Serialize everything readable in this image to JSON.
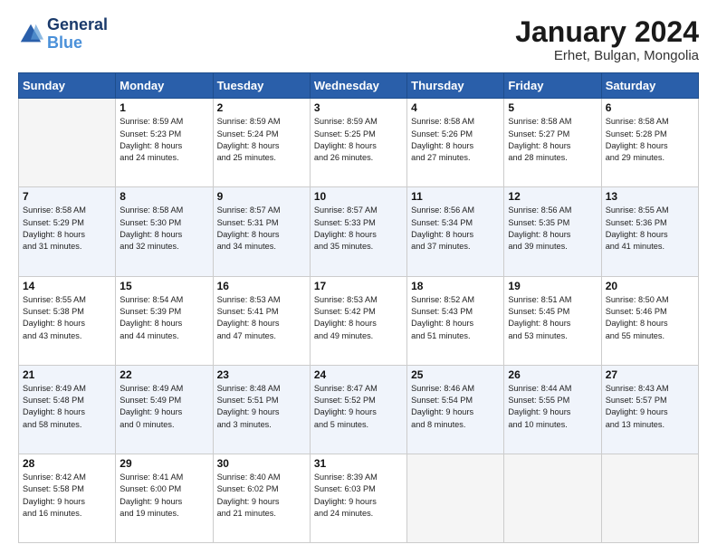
{
  "header": {
    "logo_line1": "General",
    "logo_line2": "Blue",
    "title": "January 2024",
    "subtitle": "Erhet, Bulgan, Mongolia"
  },
  "days_of_week": [
    "Sunday",
    "Monday",
    "Tuesday",
    "Wednesday",
    "Thursday",
    "Friday",
    "Saturday"
  ],
  "weeks": [
    [
      {
        "day": "",
        "info": ""
      },
      {
        "day": "1",
        "info": "Sunrise: 8:59 AM\nSunset: 5:23 PM\nDaylight: 8 hours\nand 24 minutes."
      },
      {
        "day": "2",
        "info": "Sunrise: 8:59 AM\nSunset: 5:24 PM\nDaylight: 8 hours\nand 25 minutes."
      },
      {
        "day": "3",
        "info": "Sunrise: 8:59 AM\nSunset: 5:25 PM\nDaylight: 8 hours\nand 26 minutes."
      },
      {
        "day": "4",
        "info": "Sunrise: 8:58 AM\nSunset: 5:26 PM\nDaylight: 8 hours\nand 27 minutes."
      },
      {
        "day": "5",
        "info": "Sunrise: 8:58 AM\nSunset: 5:27 PM\nDaylight: 8 hours\nand 28 minutes."
      },
      {
        "day": "6",
        "info": "Sunrise: 8:58 AM\nSunset: 5:28 PM\nDaylight: 8 hours\nand 29 minutes."
      }
    ],
    [
      {
        "day": "7",
        "info": "Sunrise: 8:58 AM\nSunset: 5:29 PM\nDaylight: 8 hours\nand 31 minutes."
      },
      {
        "day": "8",
        "info": "Sunrise: 8:58 AM\nSunset: 5:30 PM\nDaylight: 8 hours\nand 32 minutes."
      },
      {
        "day": "9",
        "info": "Sunrise: 8:57 AM\nSunset: 5:31 PM\nDaylight: 8 hours\nand 34 minutes."
      },
      {
        "day": "10",
        "info": "Sunrise: 8:57 AM\nSunset: 5:33 PM\nDaylight: 8 hours\nand 35 minutes."
      },
      {
        "day": "11",
        "info": "Sunrise: 8:56 AM\nSunset: 5:34 PM\nDaylight: 8 hours\nand 37 minutes."
      },
      {
        "day": "12",
        "info": "Sunrise: 8:56 AM\nSunset: 5:35 PM\nDaylight: 8 hours\nand 39 minutes."
      },
      {
        "day": "13",
        "info": "Sunrise: 8:55 AM\nSunset: 5:36 PM\nDaylight: 8 hours\nand 41 minutes."
      }
    ],
    [
      {
        "day": "14",
        "info": "Sunrise: 8:55 AM\nSunset: 5:38 PM\nDaylight: 8 hours\nand 43 minutes."
      },
      {
        "day": "15",
        "info": "Sunrise: 8:54 AM\nSunset: 5:39 PM\nDaylight: 8 hours\nand 44 minutes."
      },
      {
        "day": "16",
        "info": "Sunrise: 8:53 AM\nSunset: 5:41 PM\nDaylight: 8 hours\nand 47 minutes."
      },
      {
        "day": "17",
        "info": "Sunrise: 8:53 AM\nSunset: 5:42 PM\nDaylight: 8 hours\nand 49 minutes."
      },
      {
        "day": "18",
        "info": "Sunrise: 8:52 AM\nSunset: 5:43 PM\nDaylight: 8 hours\nand 51 minutes."
      },
      {
        "day": "19",
        "info": "Sunrise: 8:51 AM\nSunset: 5:45 PM\nDaylight: 8 hours\nand 53 minutes."
      },
      {
        "day": "20",
        "info": "Sunrise: 8:50 AM\nSunset: 5:46 PM\nDaylight: 8 hours\nand 55 minutes."
      }
    ],
    [
      {
        "day": "21",
        "info": "Sunrise: 8:49 AM\nSunset: 5:48 PM\nDaylight: 8 hours\nand 58 minutes."
      },
      {
        "day": "22",
        "info": "Sunrise: 8:49 AM\nSunset: 5:49 PM\nDaylight: 9 hours\nand 0 minutes."
      },
      {
        "day": "23",
        "info": "Sunrise: 8:48 AM\nSunset: 5:51 PM\nDaylight: 9 hours\nand 3 minutes."
      },
      {
        "day": "24",
        "info": "Sunrise: 8:47 AM\nSunset: 5:52 PM\nDaylight: 9 hours\nand 5 minutes."
      },
      {
        "day": "25",
        "info": "Sunrise: 8:46 AM\nSunset: 5:54 PM\nDaylight: 9 hours\nand 8 minutes."
      },
      {
        "day": "26",
        "info": "Sunrise: 8:44 AM\nSunset: 5:55 PM\nDaylight: 9 hours\nand 10 minutes."
      },
      {
        "day": "27",
        "info": "Sunrise: 8:43 AM\nSunset: 5:57 PM\nDaylight: 9 hours\nand 13 minutes."
      }
    ],
    [
      {
        "day": "28",
        "info": "Sunrise: 8:42 AM\nSunset: 5:58 PM\nDaylight: 9 hours\nand 16 minutes."
      },
      {
        "day": "29",
        "info": "Sunrise: 8:41 AM\nSunset: 6:00 PM\nDaylight: 9 hours\nand 19 minutes."
      },
      {
        "day": "30",
        "info": "Sunrise: 8:40 AM\nSunset: 6:02 PM\nDaylight: 9 hours\nand 21 minutes."
      },
      {
        "day": "31",
        "info": "Sunrise: 8:39 AM\nSunset: 6:03 PM\nDaylight: 9 hours\nand 24 minutes."
      },
      {
        "day": "",
        "info": ""
      },
      {
        "day": "",
        "info": ""
      },
      {
        "day": "",
        "info": ""
      }
    ]
  ]
}
